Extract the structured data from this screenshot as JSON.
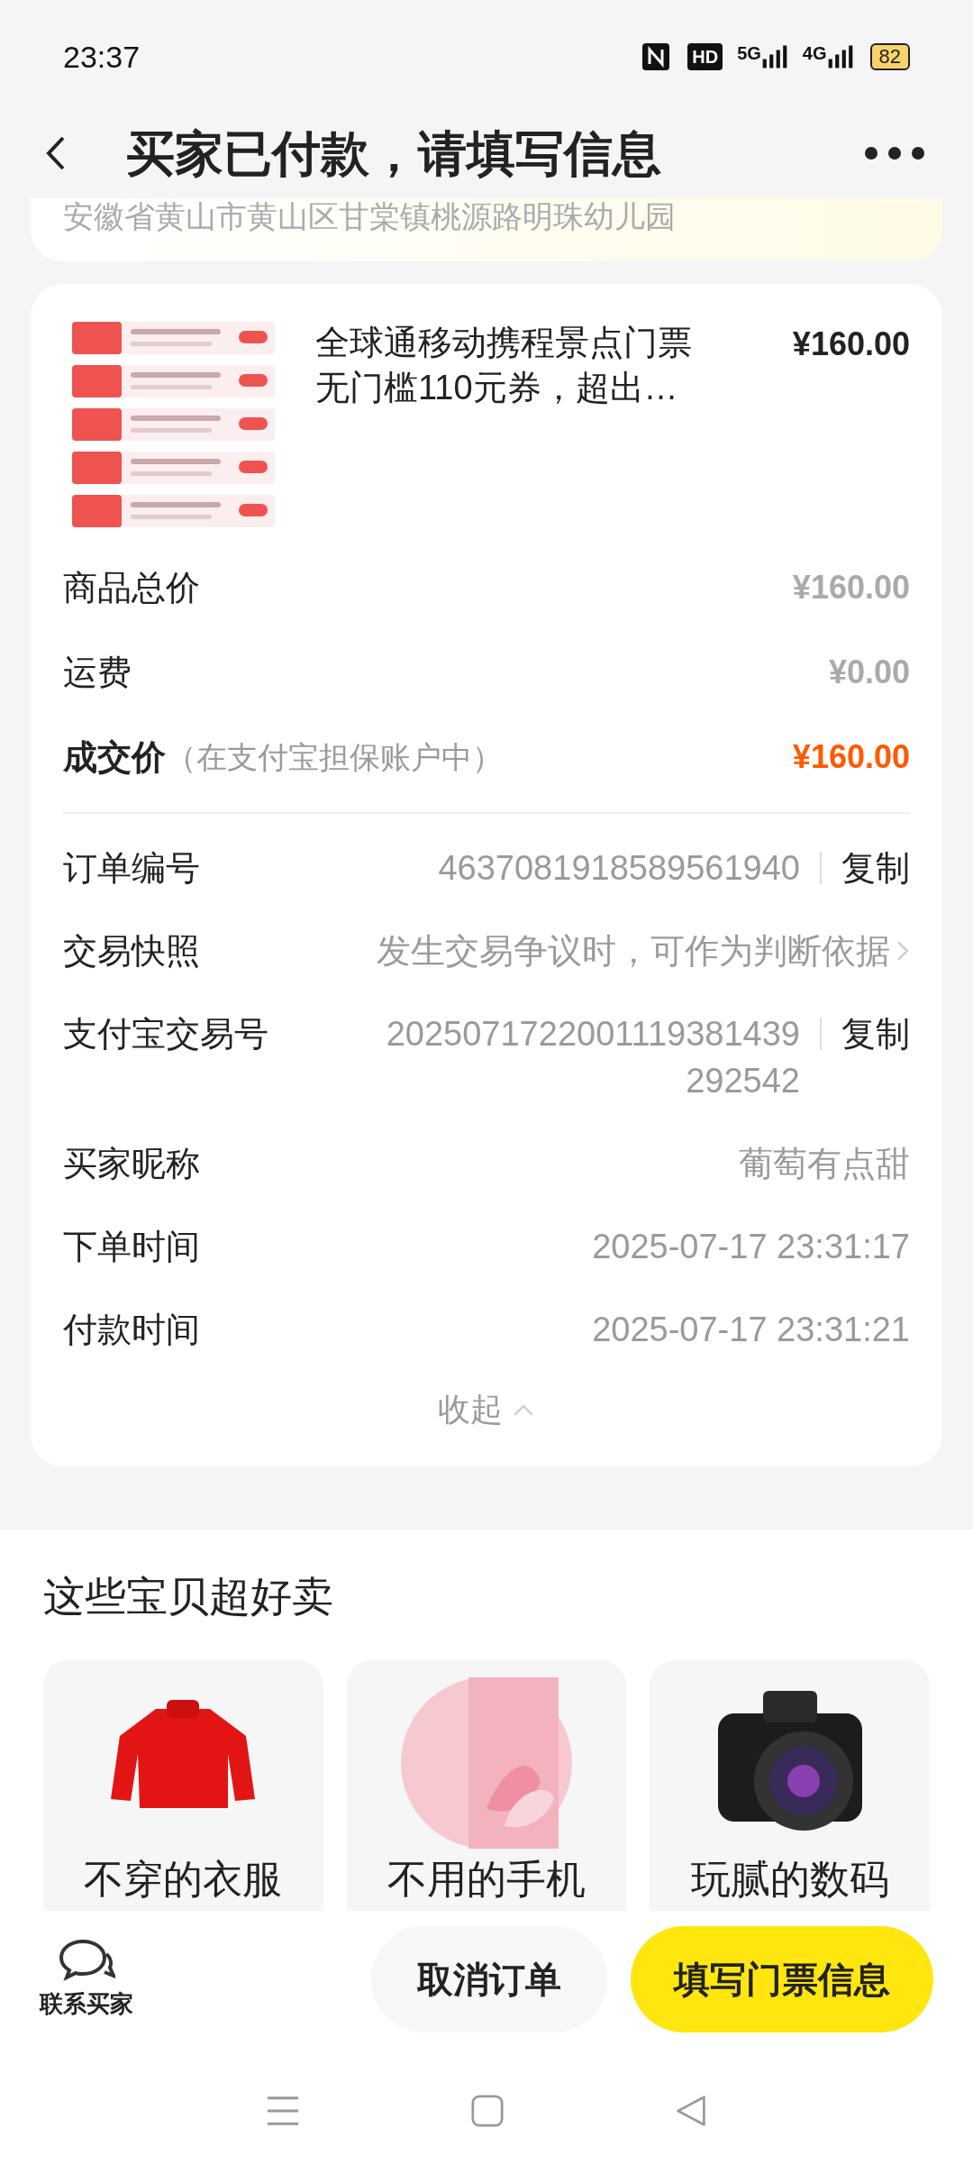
{
  "status_bar": {
    "time": "23:37",
    "hd_badge": "HD",
    "network_1": "5G",
    "network_2": "4G",
    "battery": "82"
  },
  "header": {
    "title": "买家已付款，请填写信息"
  },
  "address": {
    "text": "安徽省黄山市黄山区甘棠镇桃源路明珠幼儿园"
  },
  "product": {
    "title": "全球通移动携程景点门票无门槛110元券，超出…",
    "price": "¥160.00"
  },
  "price_rows": [
    {
      "kind": "plain",
      "label": "商品总价",
      "value": "¥160.00"
    },
    {
      "kind": "plain",
      "label": "运费",
      "value": "¥0.00"
    },
    {
      "kind": "total",
      "label": "成交价",
      "note": "（在支付宝担保账户中）",
      "value": "¥160.00"
    }
  ],
  "info_rows": [
    {
      "kind": "copy",
      "label": "订单编号",
      "value": "4637081918589561940",
      "action": "复制"
    },
    {
      "kind": "link",
      "label": "交易快照",
      "value": "发生交易争议时，可作为判断依据"
    },
    {
      "kind": "copy",
      "label": "支付宝交易号",
      "value": "2025071722001119381439292542",
      "action": "复制"
    },
    {
      "kind": "plain",
      "label": "买家昵称",
      "value": "葡萄有点甜"
    },
    {
      "kind": "plain",
      "label": "下单时间",
      "value": "2025-07-17 23:31:17"
    },
    {
      "kind": "plain",
      "label": "付款时间",
      "value": "2025-07-17 23:31:21"
    }
  ],
  "collapse": {
    "label": "收起"
  },
  "recommend": {
    "title": "这些宝贝超好卖",
    "items": [
      {
        "kind": "sweater",
        "label": "不穿的衣服"
      },
      {
        "kind": "phone",
        "label": "不用的手机"
      },
      {
        "kind": "camera",
        "label": "玩腻的数码"
      }
    ]
  },
  "bottom_bar": {
    "contact": "联系买家",
    "cancel": "取消订单",
    "primary": "填写门票信息"
  }
}
